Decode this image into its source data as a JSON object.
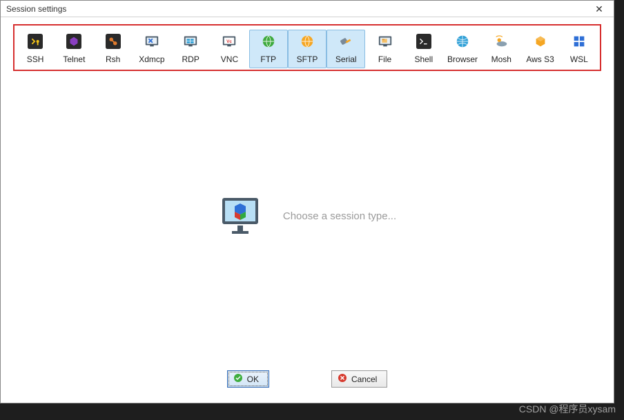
{
  "window": {
    "title": "Session settings"
  },
  "toolbar": {
    "items": [
      {
        "id": "ssh",
        "label": "SSH",
        "hl": false
      },
      {
        "id": "telnet",
        "label": "Telnet",
        "hl": false
      },
      {
        "id": "rsh",
        "label": "Rsh",
        "hl": false
      },
      {
        "id": "xdmcp",
        "label": "Xdmcp",
        "hl": false
      },
      {
        "id": "rdp",
        "label": "RDP",
        "hl": false
      },
      {
        "id": "vnc",
        "label": "VNC",
        "hl": false
      },
      {
        "id": "ftp",
        "label": "FTP",
        "hl": true
      },
      {
        "id": "sftp",
        "label": "SFTP",
        "hl": true
      },
      {
        "id": "serial",
        "label": "Serial",
        "hl": true
      },
      {
        "id": "file",
        "label": "File",
        "hl": false
      },
      {
        "id": "shell",
        "label": "Shell",
        "hl": false
      },
      {
        "id": "browser",
        "label": "Browser",
        "hl": false
      },
      {
        "id": "mosh",
        "label": "Mosh",
        "hl": false
      },
      {
        "id": "awss3",
        "label": "Aws S3",
        "hl": false
      },
      {
        "id": "wsl",
        "label": "WSL",
        "hl": false
      }
    ]
  },
  "main": {
    "prompt": "Choose a session type..."
  },
  "buttons": {
    "ok": "OK",
    "cancel": "Cancel"
  },
  "watermark": "CSDN @程序员xysam"
}
